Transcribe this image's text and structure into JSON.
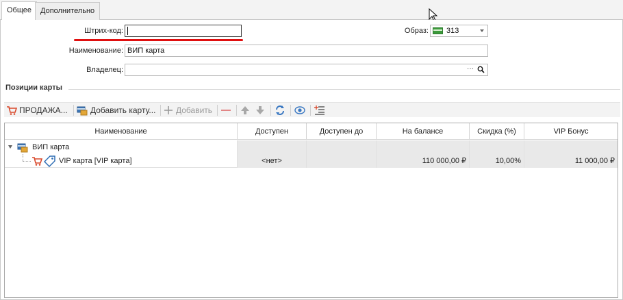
{
  "tabs": [
    {
      "label": "Общее",
      "active": true
    },
    {
      "label": "Дополнительно",
      "active": false
    }
  ],
  "form": {
    "barcode_label": "Штрих-код:",
    "barcode_value": "",
    "image_label": "Образ:",
    "image_value": "313",
    "name_label": "Наименование:",
    "name_value": "ВИП карта",
    "owner_label": "Владелец:",
    "owner_value": "",
    "owner_ellipsis": "···"
  },
  "section": {
    "title": "Позиции карты"
  },
  "toolbar": {
    "sales_label": "ПРОДАЖА...",
    "add_card_label": "Добавить карту...",
    "add_label": "Добавить"
  },
  "grid": {
    "columns": [
      "Наименование",
      "Доступен",
      "Доступен до",
      "На балансе",
      "Скидка (%)",
      "VIP Бонус"
    ],
    "group": {
      "label": "ВИП карта"
    },
    "rows": [
      {
        "name": "VIP карта [VIP карта]",
        "available": "<нет>",
        "available_until": "",
        "balance": "110 000,00 ₽",
        "discount": "10,00%",
        "vip_bonus": "11 000,00 ₽"
      }
    ]
  },
  "colors": {
    "highlight": "#e01010",
    "accent_blue": "#2e6db4"
  }
}
